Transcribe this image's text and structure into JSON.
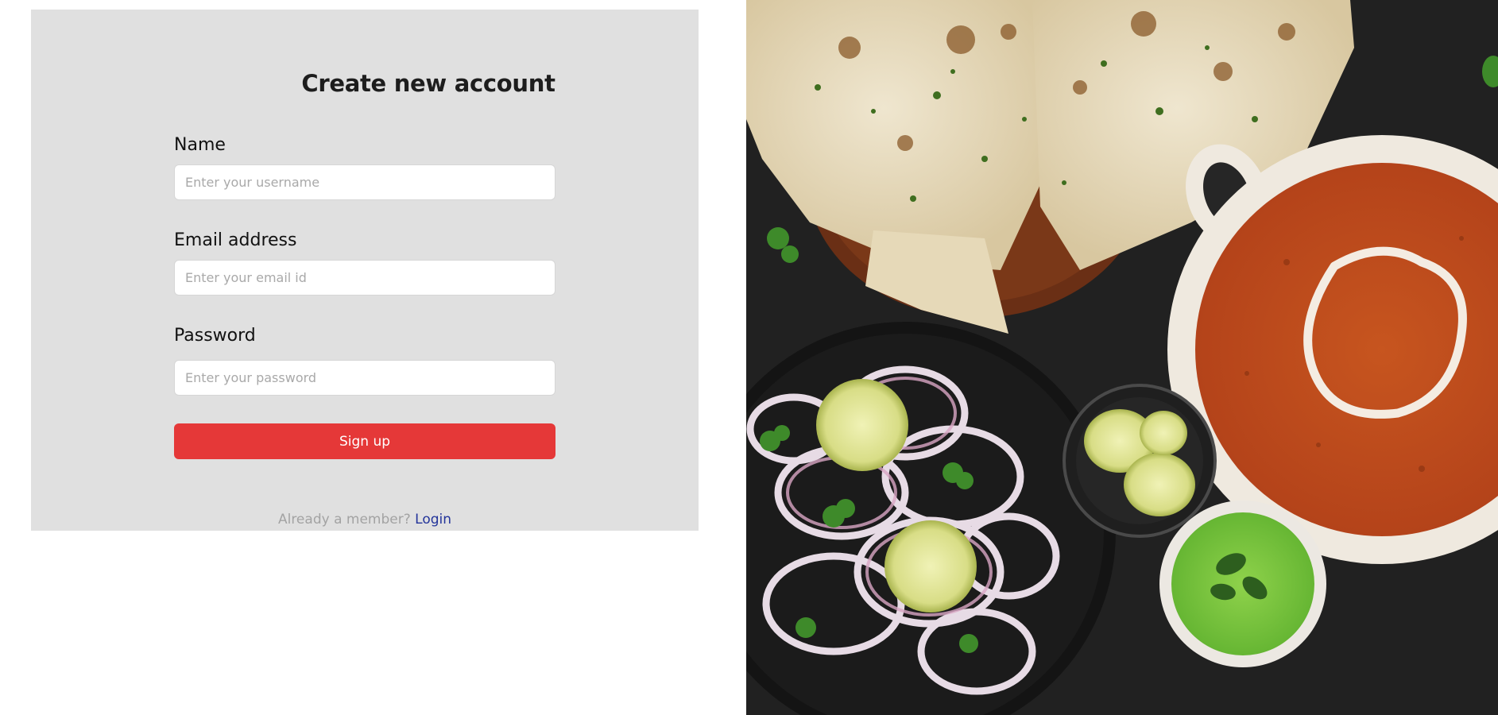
{
  "form": {
    "title": "Create new account",
    "name_label": "Name",
    "name_placeholder": "Enter your username",
    "email_label": "Email address",
    "email_placeholder": "Enter your email id",
    "password_label": "Password",
    "password_placeholder": "Enter your password",
    "signup_label": "Sign up",
    "member_prompt": "Already a member?",
    "login_label": "Login"
  },
  "colors": {
    "card_background": "#e0e0e0",
    "signup_button": "#e53838",
    "login_link": "#23349a"
  },
  "image": {
    "icon": "food-photo-icon"
  }
}
